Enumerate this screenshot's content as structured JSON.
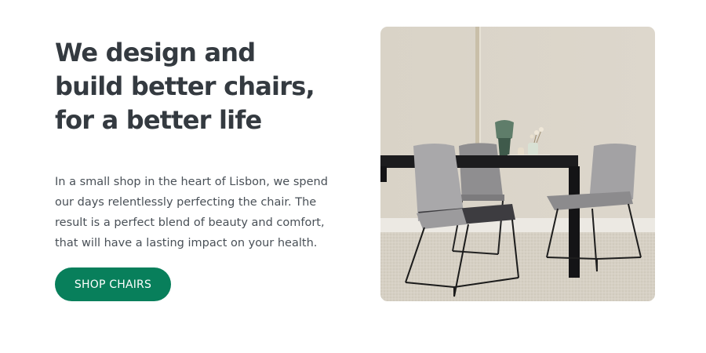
{
  "hero": {
    "headline": "We design and build better chairs, for a better life",
    "description": "In a small shop in the heart of Lisbon, we spend our days relentlessly perfecting the chair. The result is a perfect blend of beauty and comfort, that will have a lasting impact on your health.",
    "cta_label": "SHOP CHAIRS",
    "image_alt": "Photo of gray dining chairs around a black table"
  },
  "colors": {
    "accent": "#087f5b",
    "heading": "#343a40",
    "body_text": "#495057",
    "background": "#ffffff"
  }
}
